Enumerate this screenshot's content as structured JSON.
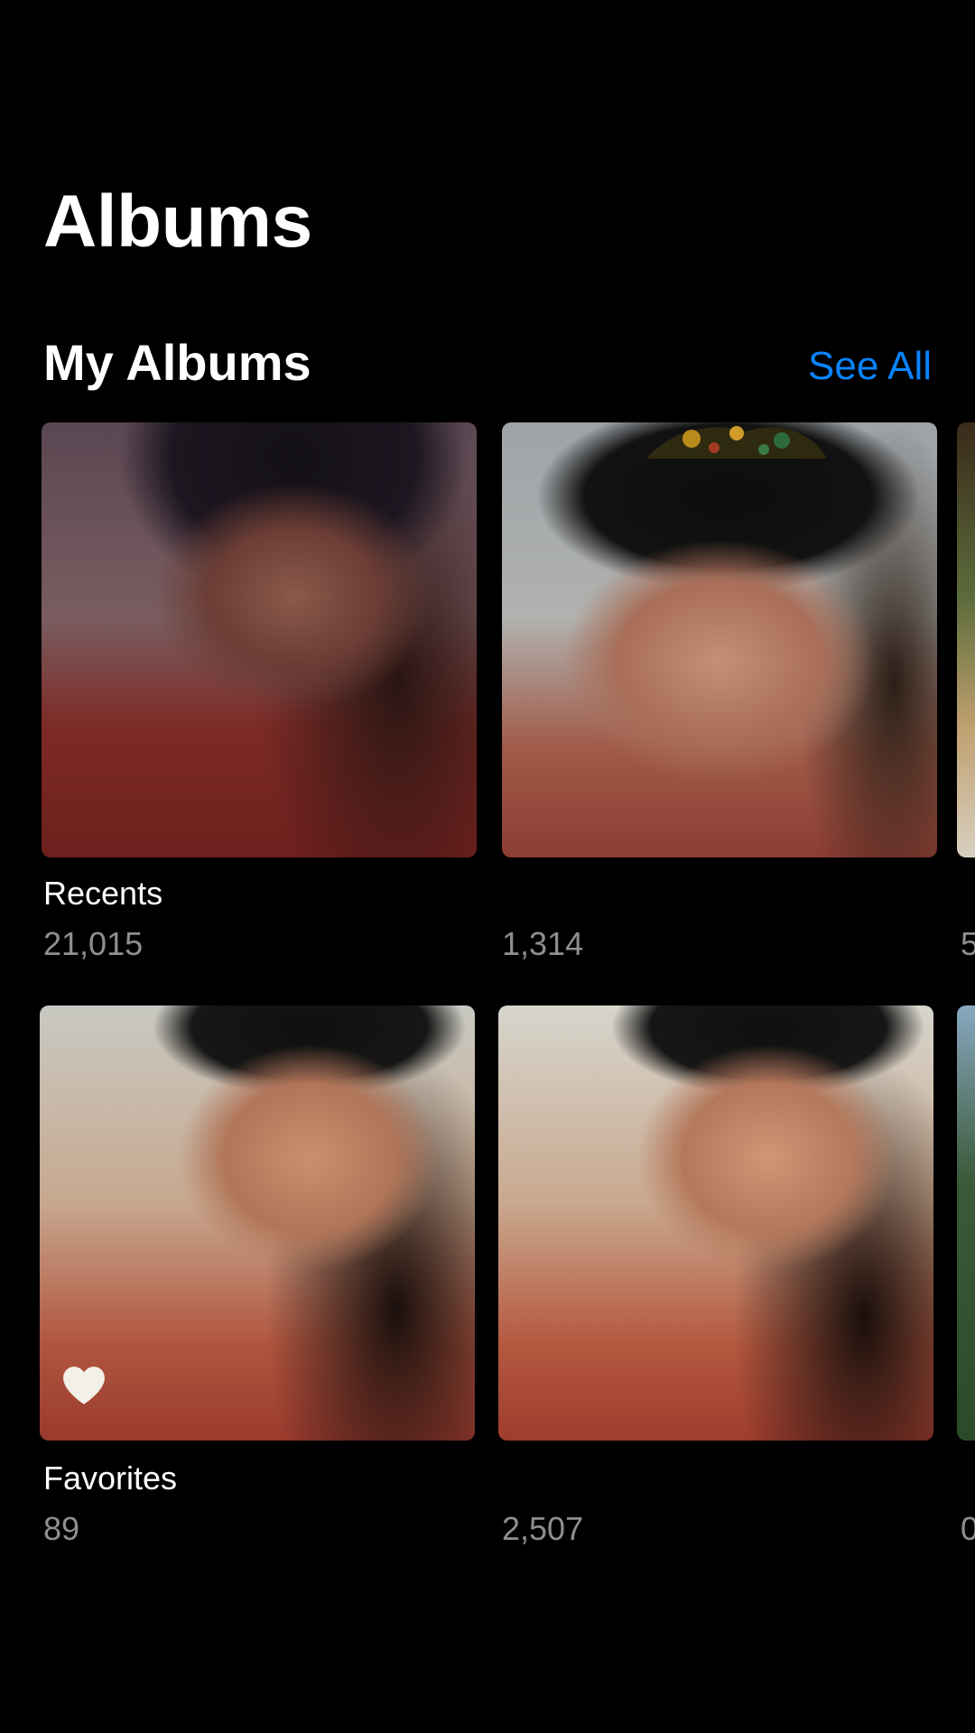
{
  "header": {
    "title": "Albums"
  },
  "my_albums": {
    "section_title": "My Albums",
    "see_all_label": "See All",
    "rows": [
      [
        {
          "name": "Recents",
          "count": "21,015",
          "photo": "portrait-dim-tones"
        },
        {
          "name": "",
          "count": "1,314",
          "photo": "portrait-black-durag-gold-pattern"
        },
        {
          "name": "",
          "count": "5",
          "photo": "food-plate"
        }
      ],
      [
        {
          "name": "Favorites",
          "count": "89",
          "photo": "portrait-warm-tones",
          "badge_icon": "heart-icon"
        },
        {
          "name": "",
          "count": "2,507",
          "photo": "portrait-warm-tones-2"
        },
        {
          "name": "",
          "count": "0",
          "photo": "outdoor-trees"
        }
      ]
    ]
  },
  "colors": {
    "background": "#000000",
    "accent": "#0a84ff",
    "secondary_text": "#8e8e93"
  }
}
